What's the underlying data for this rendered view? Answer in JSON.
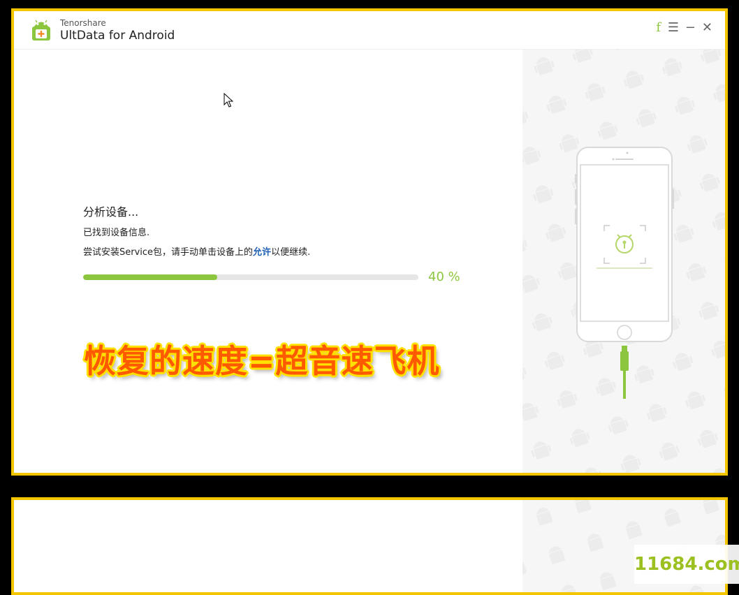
{
  "app": {
    "brand": "Tenorshare",
    "product": "UltData for Android"
  },
  "window_controls": {
    "facebook": "f",
    "menu": "☰",
    "minimize": "−",
    "close": "✕"
  },
  "status": {
    "title": "分析设备...",
    "line1": "已找到设备信息.",
    "line2_before": "尝试安装Service包，请手动单击设备上的",
    "line2_allow": "允许",
    "line2_after": "以便继续.",
    "progress_percent": 40,
    "progress_label": "40 %"
  },
  "overlay_caption": "恢复的速度=超音速飞机",
  "watermark": "11684.com",
  "colors": {
    "accent": "#8cc63f",
    "link": "#1e5fb4",
    "frame": "#f2c500",
    "caption": "#ff5a00",
    "caption_outline": "#ffe100"
  },
  "icons": [
    "android-logo-icon",
    "facebook-icon",
    "menu-icon",
    "minimize-icon",
    "close-icon",
    "mouse-cursor-icon",
    "phone-illustration",
    "usb-cable-icon",
    "unlock-icon"
  ]
}
